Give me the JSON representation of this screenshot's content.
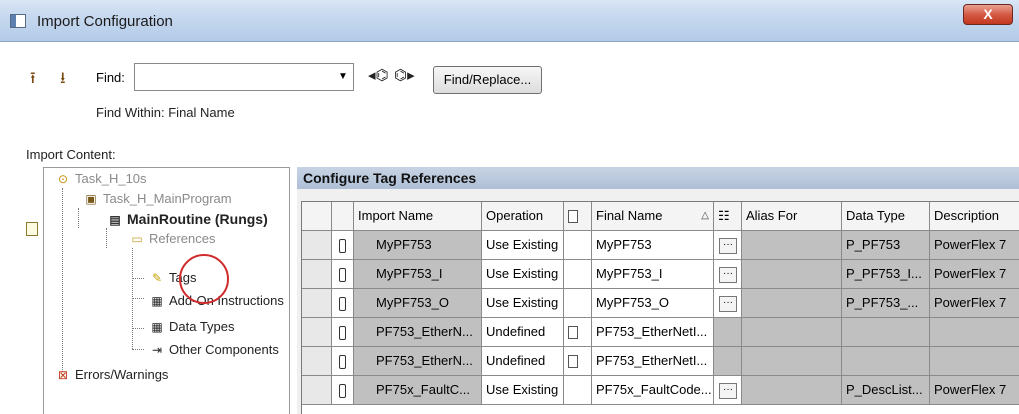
{
  "window": {
    "title": "Import Configuration",
    "close_label": "X"
  },
  "toolbar": {
    "find_label": "Find:",
    "find_value": "",
    "find_replace_label": "Find/Replace...",
    "find_within": "Find Within: Final Name"
  },
  "import_content_label": "Import Content:",
  "tree": {
    "items": [
      {
        "label": "Task_H_10s",
        "style": "grey"
      },
      {
        "label": "Task_H_MainProgram",
        "style": "grey"
      },
      {
        "label": "MainRoutine (Rungs)",
        "style": "bold"
      },
      {
        "label": "References",
        "style": "grey"
      },
      {
        "label": "Tags",
        "style": "normal"
      },
      {
        "label": "Add-On Instructions",
        "style": "normal"
      },
      {
        "label": "Data Types",
        "style": "normal"
      },
      {
        "label": "Other Components",
        "style": "normal"
      },
      {
        "label": "Errors/Warnings",
        "style": "normal"
      }
    ]
  },
  "grid": {
    "title": "Configure Tag References",
    "columns": [
      "Import Name",
      "Operation",
      "",
      "Final Name",
      "",
      "Alias For",
      "Data Type",
      "Description"
    ],
    "rows": [
      {
        "import_name": "MyPF753",
        "operation": "Use Existing",
        "final_name": "MyPF753",
        "alias_for": "",
        "data_type": "P_PF753",
        "description": "PowerFlex 7",
        "has_doc": false,
        "has_ellipsis": true
      },
      {
        "import_name": "MyPF753_I",
        "operation": "Use Existing",
        "final_name": "MyPF753_I",
        "alias_for": "",
        "data_type": "P_PF753_I...",
        "description": "PowerFlex 7",
        "has_doc": false,
        "has_ellipsis": true
      },
      {
        "import_name": "MyPF753_O",
        "operation": "Use Existing",
        "final_name": "MyPF753_O",
        "alias_for": "",
        "data_type": "P_PF753_...",
        "description": "PowerFlex 7",
        "has_doc": false,
        "has_ellipsis": true
      },
      {
        "import_name": "PF753_EtherN...",
        "operation": "Undefined",
        "final_name": "PF753_EtherNetI...",
        "alias_for": "",
        "data_type": "",
        "description": "",
        "has_doc": true,
        "has_ellipsis": false
      },
      {
        "import_name": "PF753_EtherN...",
        "operation": "Undefined",
        "final_name": "PF753_EtherNetI...",
        "alias_for": "",
        "data_type": "",
        "description": "",
        "has_doc": true,
        "has_ellipsis": false
      },
      {
        "import_name": "PF75x_FaultC...",
        "operation": "Use Existing",
        "final_name": "PF75x_FaultCode...",
        "alias_for": "",
        "data_type": "P_DescList...",
        "description": "PowerFlex 7",
        "has_doc": false,
        "has_ellipsis": true
      }
    ]
  }
}
